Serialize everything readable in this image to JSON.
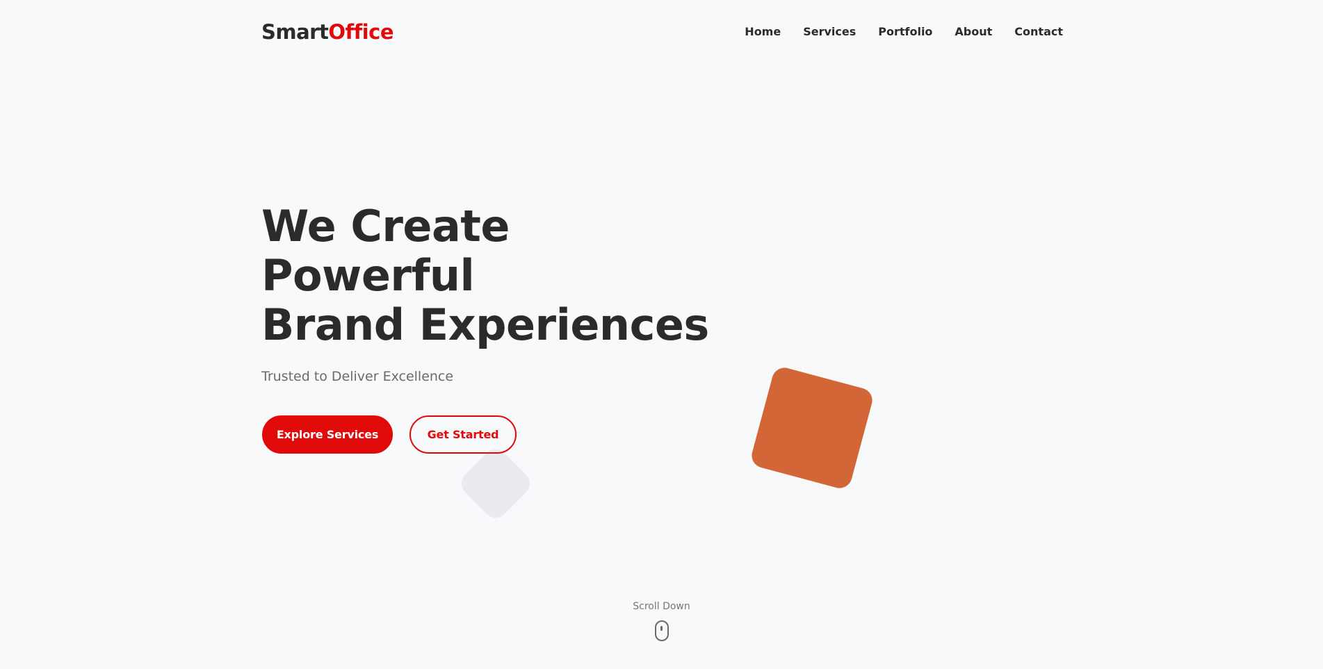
{
  "brand": {
    "name_part1": "Smart",
    "name_part2": "Office"
  },
  "nav": {
    "items": [
      {
        "label": "Home"
      },
      {
        "label": "Services"
      },
      {
        "label": "Portfolio"
      },
      {
        "label": "About"
      },
      {
        "label": "Contact"
      }
    ]
  },
  "hero": {
    "title_lines": [
      "We Create",
      "Powerful",
      "Brand Experiences"
    ],
    "subtitle": "Trusted to Deliver Excellence",
    "primary_button": "Explore Services",
    "secondary_button": "Get Started"
  },
  "scroll": {
    "label": "Scroll Down",
    "icon": "mouse-icon"
  },
  "colors": {
    "accent": "#e00a0a",
    "text": "#2b2b2b",
    "background": "#f8f9fa",
    "shape_orange": "#d26636",
    "shape_gray": "#e8eaed"
  }
}
